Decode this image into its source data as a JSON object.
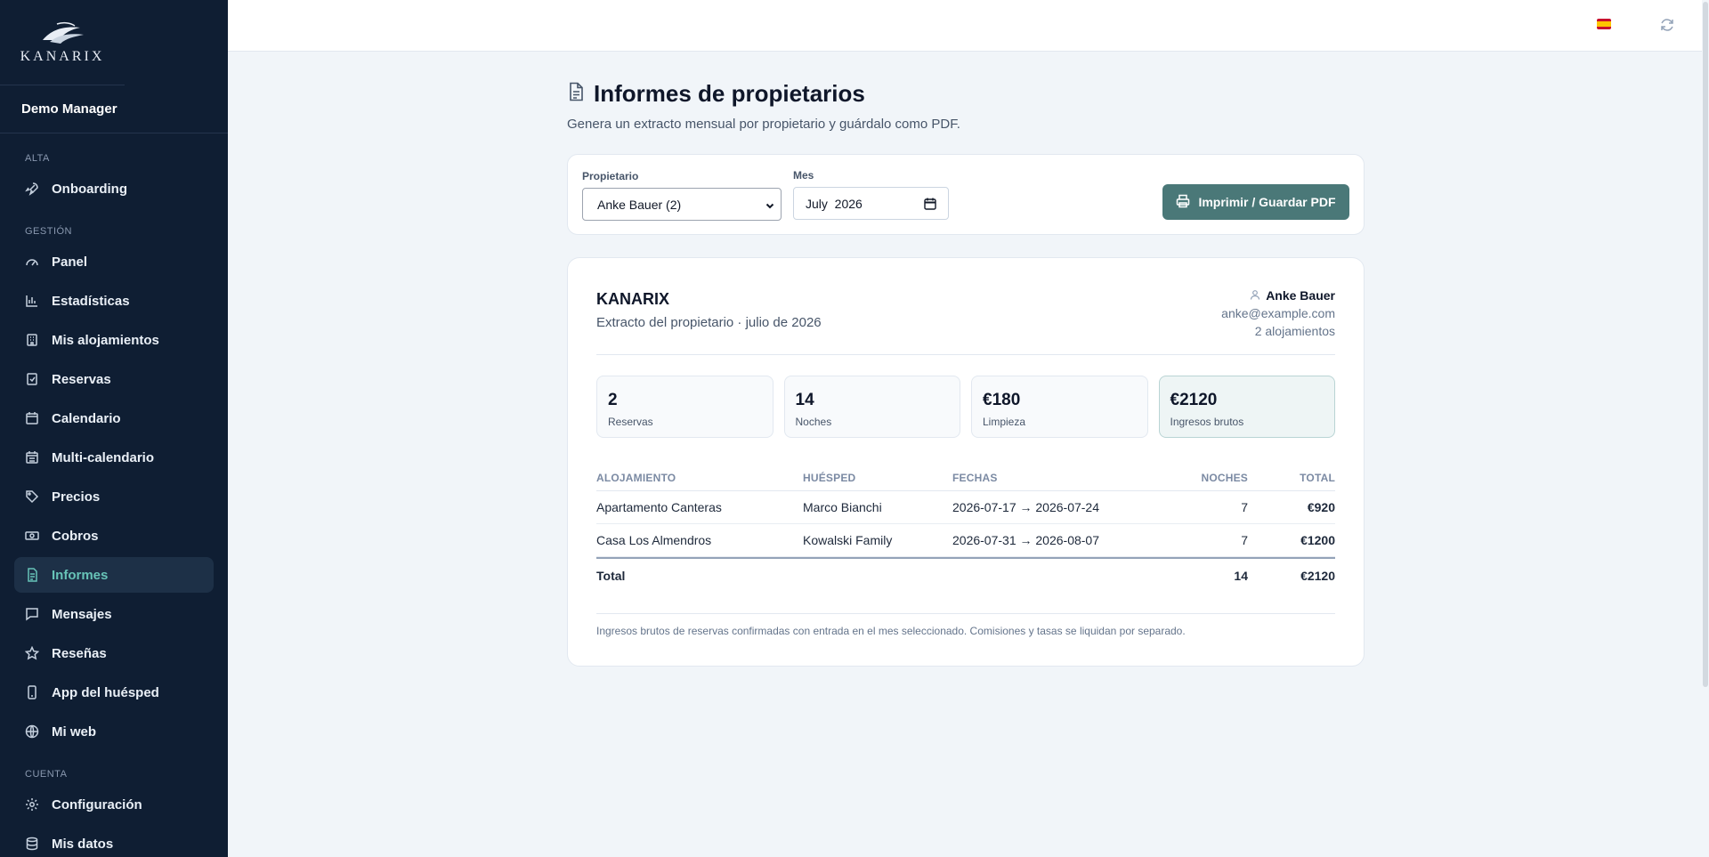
{
  "app": {
    "brand": "KANARIX",
    "user": "Demo Manager"
  },
  "sidebar": {
    "sections": [
      {
        "label": "ALTA",
        "items": [
          {
            "label": "Onboarding",
            "icon": "rocket-icon"
          }
        ]
      },
      {
        "label": "GESTIÓN",
        "items": [
          {
            "label": "Panel",
            "icon": "gauge-icon"
          },
          {
            "label": "Estadísticas",
            "icon": "bar-chart-icon"
          },
          {
            "label": "Mis alojamientos",
            "icon": "building-icon"
          },
          {
            "label": "Reservas",
            "icon": "clipboard-check-icon"
          },
          {
            "label": "Calendario",
            "icon": "calendar-icon"
          },
          {
            "label": "Multi-calendario",
            "icon": "calendar-grid-icon"
          },
          {
            "label": "Precios",
            "icon": "tag-icon"
          },
          {
            "label": "Cobros",
            "icon": "banknote-icon"
          },
          {
            "label": "Informes",
            "icon": "file-text-icon",
            "active": true
          },
          {
            "label": "Mensajes",
            "icon": "message-square-icon"
          },
          {
            "label": "Reseñas",
            "icon": "star-icon"
          },
          {
            "label": "App del huésped",
            "icon": "smartphone-icon"
          },
          {
            "label": "Mi web",
            "icon": "globe-icon"
          }
        ]
      },
      {
        "label": "CUENTA",
        "items": [
          {
            "label": "Configuración",
            "icon": "gear-icon"
          },
          {
            "label": "Mis datos",
            "icon": "database-icon"
          }
        ]
      }
    ]
  },
  "topbar": {
    "language_flag": "spain-flag-icon",
    "refresh_icon": "refresh-icon"
  },
  "page": {
    "title": "Informes de propietarios",
    "subtitle": "Genera un extracto mensual por propietario y guárdalo como PDF."
  },
  "filters": {
    "owner_label": "Propietario",
    "owner_value": "Anke Bauer (2)",
    "month_label": "Mes",
    "month_value": "July  2026",
    "print_label": "Imprimir / Guardar PDF"
  },
  "report": {
    "brand": "KANARIX",
    "statement": "Extracto del propietario · julio de 2026",
    "owner_name": "Anke Bauer",
    "owner_email": "anke@example.com",
    "owner_units": "2 alojamientos",
    "stats": [
      {
        "value": "2",
        "label": "Reservas"
      },
      {
        "value": "14",
        "label": "Noches"
      },
      {
        "value": "€180",
        "label": "Limpieza"
      },
      {
        "value": "€2120",
        "label": "Ingresos brutos"
      }
    ],
    "columns": [
      "ALOJAMIENTO",
      "HUÉSPED",
      "FECHAS",
      "NOCHES",
      "TOTAL"
    ],
    "rows": [
      {
        "property": "Apartamento Canteras",
        "guest": "Marco Bianchi",
        "dates": "2026-07-17 → 2026-07-24",
        "nights": "7",
        "total": "€920"
      },
      {
        "property": "Casa Los Almendros",
        "guest": "Kowalski Family",
        "dates": "2026-07-31 → 2026-08-07",
        "nights": "7",
        "total": "€1200"
      }
    ],
    "footer": {
      "label": "Total",
      "nights": "14",
      "total": "€2120"
    },
    "note": "Ingresos brutos de reservas confirmadas con entrada en el mes seleccionado. Comisiones y tasas se liquidan por separado."
  },
  "colors": {
    "sidebar_bg": "#0f1e33",
    "accent": "#67c3b8",
    "button": "#4a7878"
  }
}
